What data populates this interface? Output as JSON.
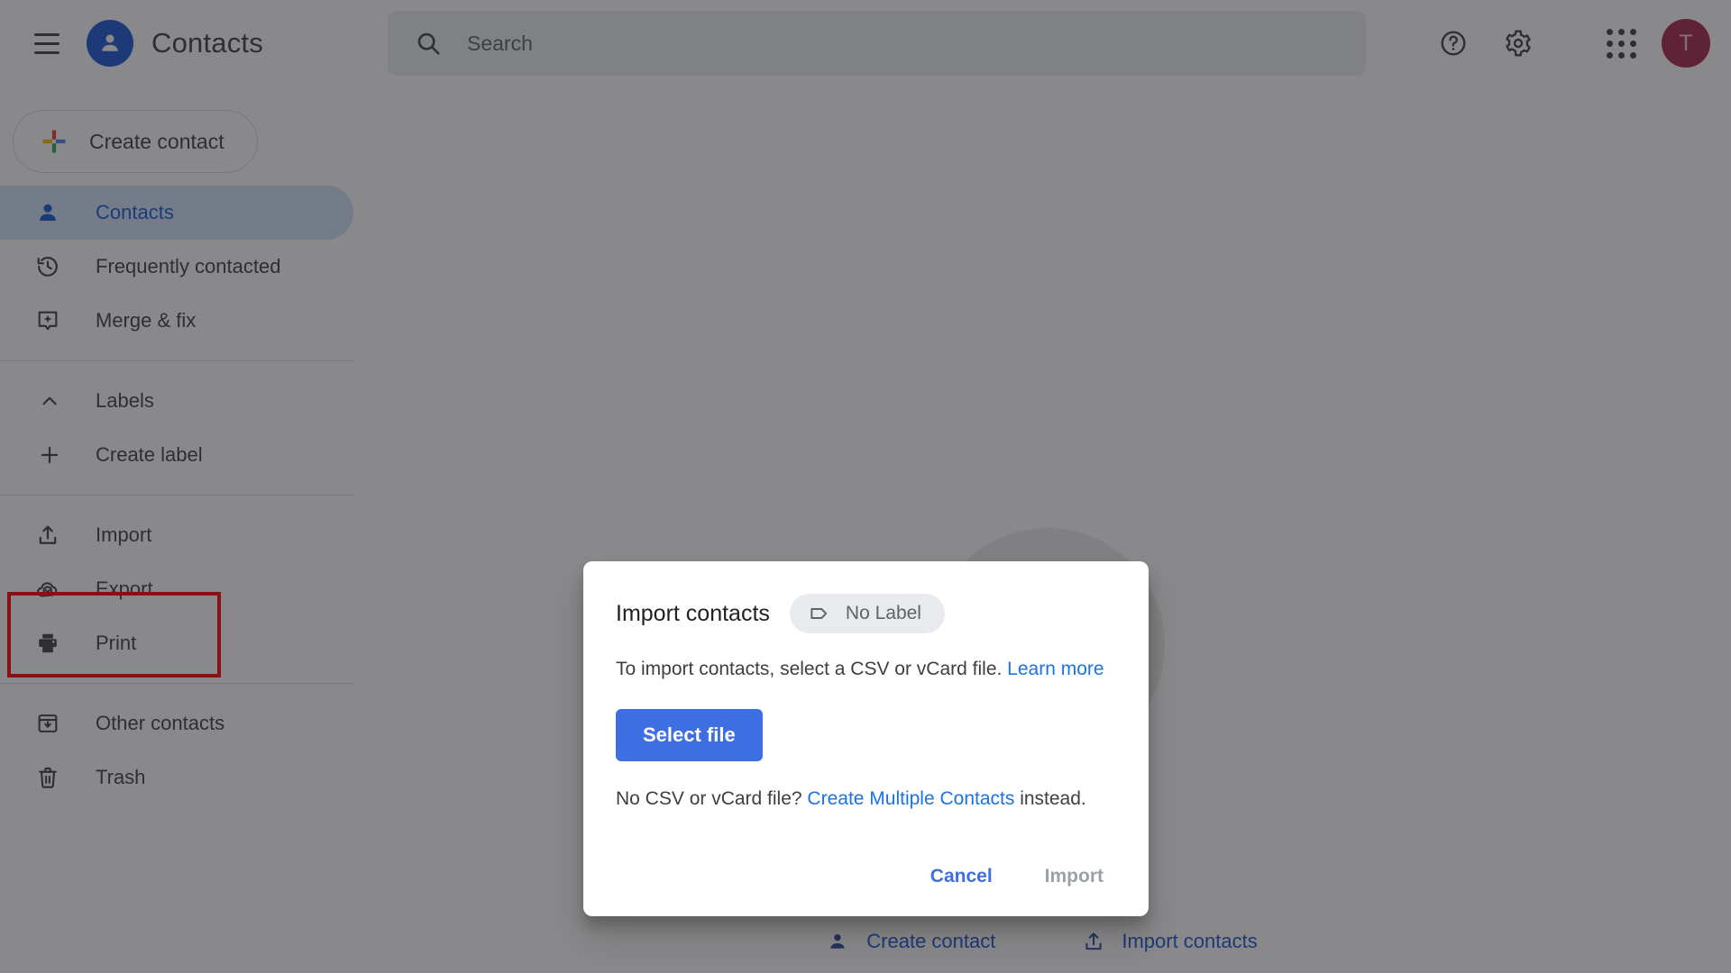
{
  "app": {
    "brand_title": "Contacts",
    "brand_logo_icon": "person-circle-icon",
    "hamburger_icon": "hamburger-menu-icon"
  },
  "topbar": {
    "search": {
      "placeholder": "Search",
      "value": "",
      "icon": "search-icon"
    },
    "help_icon": "help-circle-icon",
    "settings_icon": "gear-icon",
    "apps_icon": "apps-grid-icon",
    "avatar_initial": "T",
    "avatar_color": "#a9264b"
  },
  "sidebar": {
    "create_contact": {
      "label": "Create contact",
      "icon": "google-plus-icon"
    },
    "groups": [
      {
        "items": [
          {
            "label": "Contacts",
            "icon": "person-icon",
            "active": true
          },
          {
            "label": "Frequently contacted",
            "icon": "history-clock-icon",
            "active": false
          },
          {
            "label": "Merge & fix",
            "icon": "merge-sparkle-icon",
            "active": false
          }
        ]
      },
      {
        "items": [
          {
            "label": "Labels",
            "icon": "chevron-up-icon",
            "active": false
          },
          {
            "label": "Create label",
            "icon": "plus-icon",
            "active": false
          }
        ]
      },
      {
        "items": [
          {
            "label": "Import",
            "icon": "upload-icon",
            "active": false
          },
          {
            "label": "Export",
            "icon": "cloud-download-icon",
            "active": false
          },
          {
            "label": "Print",
            "icon": "printer-icon",
            "active": false
          }
        ]
      },
      {
        "items": [
          {
            "label": "Other contacts",
            "icon": "archive-down-icon",
            "active": false
          },
          {
            "label": "Trash",
            "icon": "trash-icon",
            "active": false
          }
        ]
      }
    ],
    "highlight_color": "#fe0000"
  },
  "main": {
    "empty_actions": [
      {
        "label": "Create contact",
        "icon": "person-add-icon"
      },
      {
        "label": "Import contacts",
        "icon": "upload-icon"
      }
    ]
  },
  "modal": {
    "title": "Import contacts",
    "label_chip": {
      "text": "No Label",
      "icon": "label-tag-icon"
    },
    "description_prefix": "To import contacts, select a CSV or vCard file. ",
    "description_link": "Learn more",
    "select_file_label": "Select file",
    "alt_prefix": "No CSV or vCard file? ",
    "alt_link": "Create Multiple Contacts",
    "alt_suffix": " instead.",
    "cancel_label": "Cancel",
    "import_label": "Import",
    "accent_color": "#3d6fe3",
    "link_color": "#1a73e8"
  }
}
